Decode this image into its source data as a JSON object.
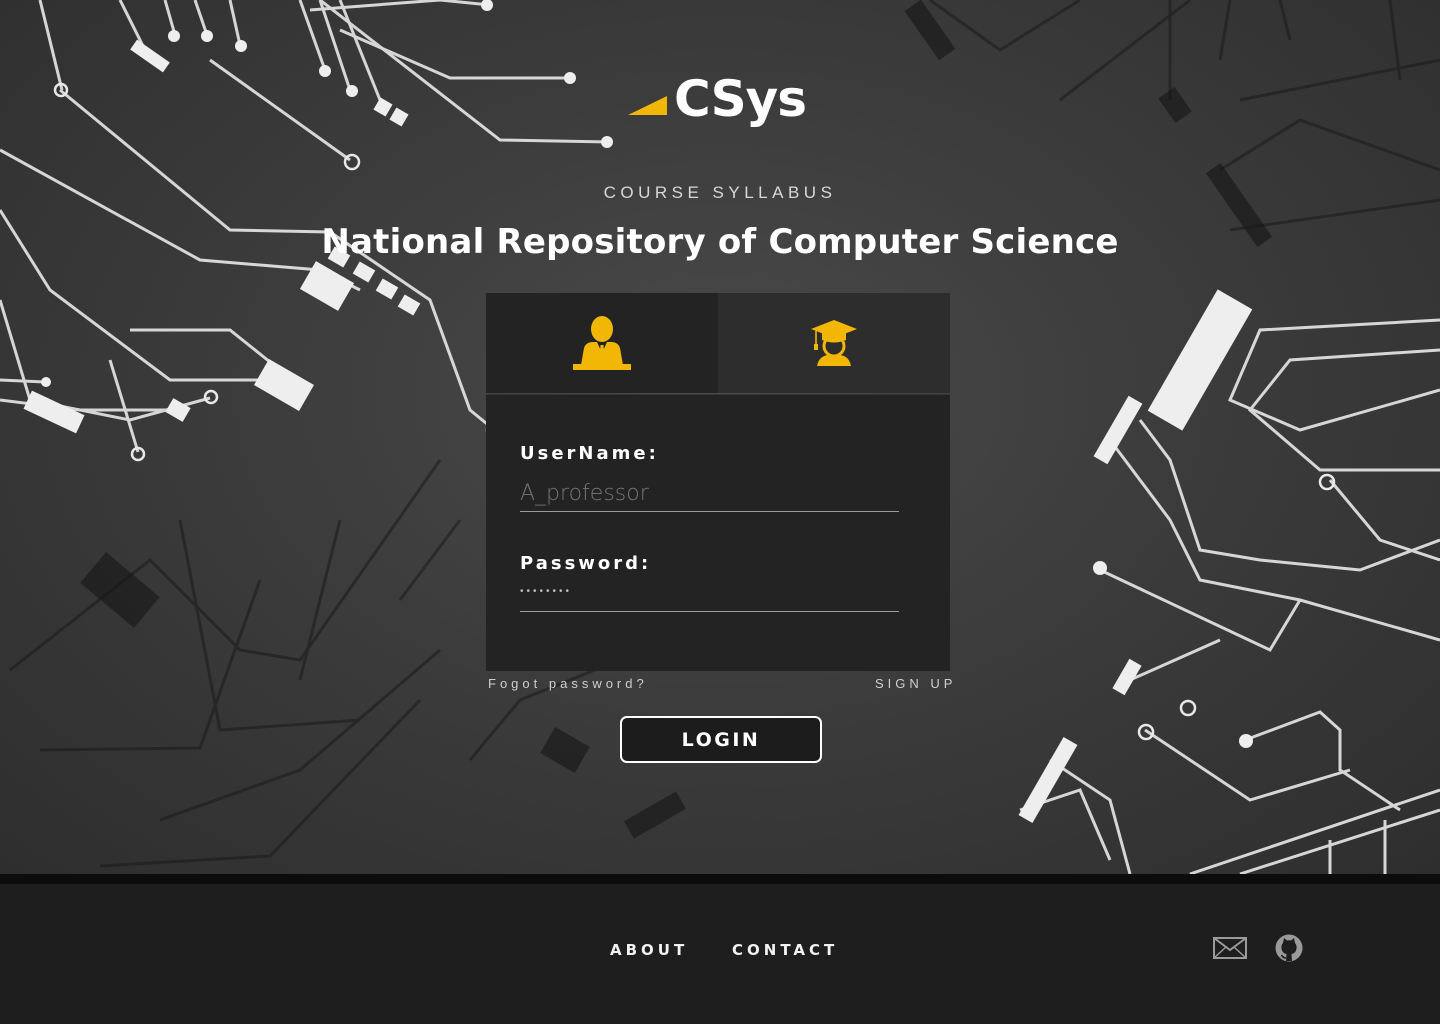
{
  "brand": {
    "name": "CSys",
    "accent_color": "#F2B705"
  },
  "hero": {
    "kicker": "COURSE SYLLABUS",
    "title": "National Repository of Computer Science"
  },
  "tabs": [
    {
      "icon": "professor-icon",
      "active": true
    },
    {
      "icon": "student-graduate-icon",
      "active": false
    }
  ],
  "form": {
    "username_label": "UserName:",
    "username_placeholder": "A_professor",
    "password_label": "Password:",
    "password_value": "••••••••"
  },
  "links": {
    "forgot_password": "Fogot password?",
    "sign_up": "SIGN UP"
  },
  "login_button": "LOGIN",
  "footer": {
    "about": "ABOUT",
    "contact": "CONTACT",
    "icons": [
      "mail-icon",
      "github-icon"
    ]
  }
}
